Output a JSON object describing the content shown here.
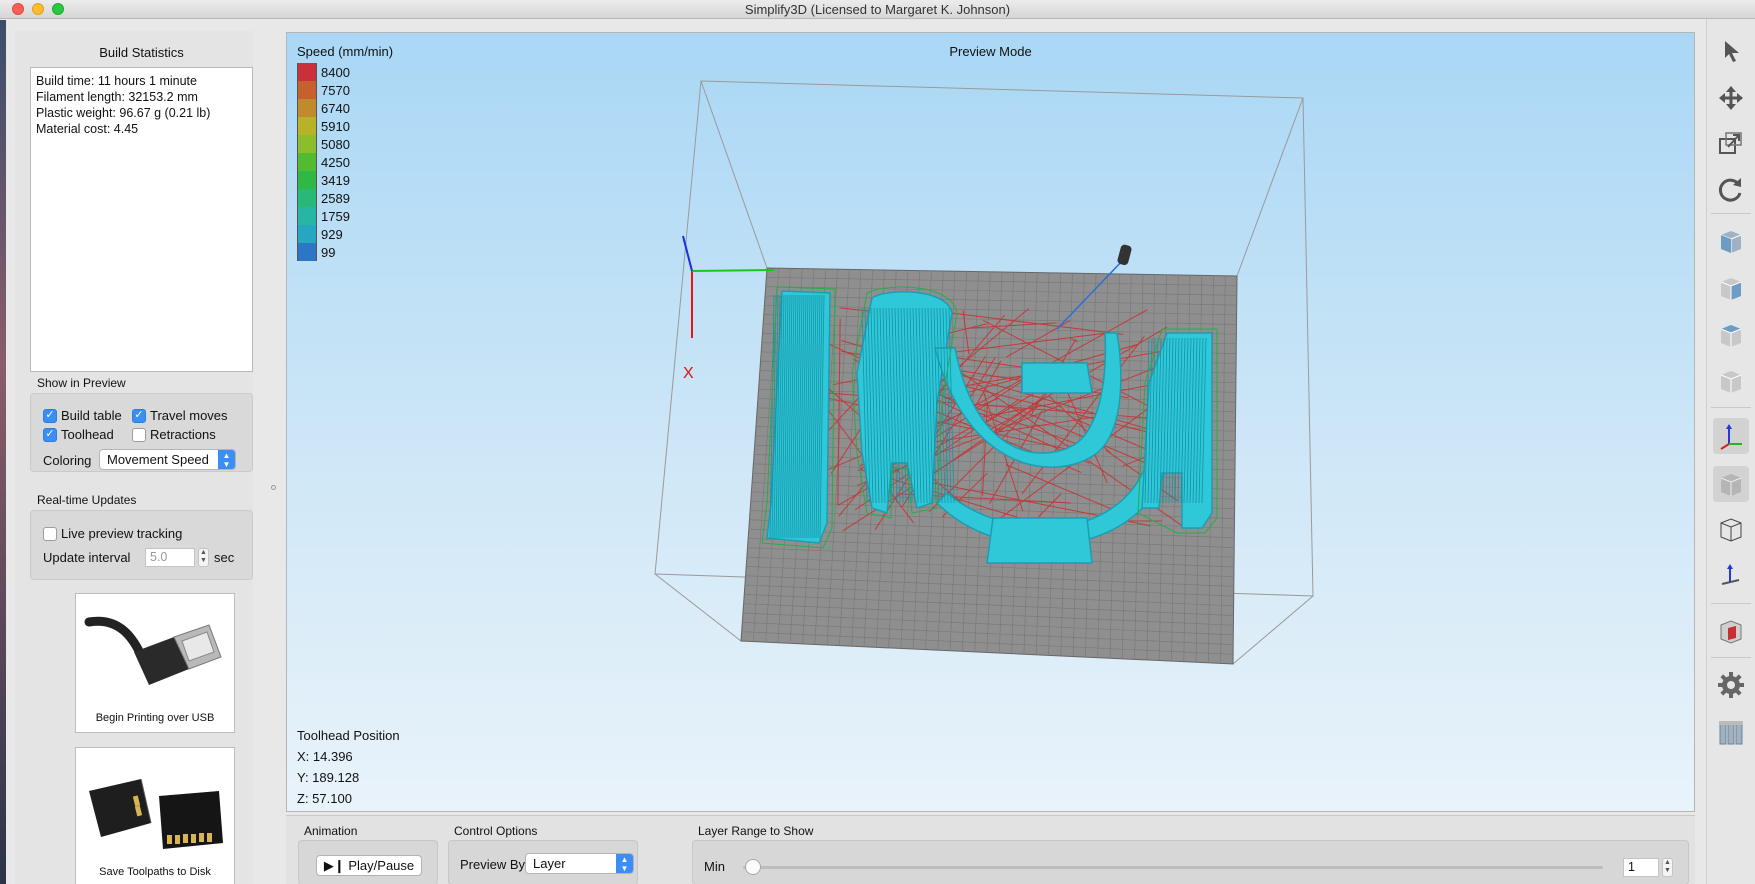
{
  "window": {
    "title": "Simplify3D (Licensed to Margaret K. Johnson)"
  },
  "build_statistics": {
    "heading": "Build Statistics",
    "lines": [
      "Build time: 11 hours 1 minute",
      "Filament length: 32153.2 mm",
      "Plastic weight: 96.67 g (0.21 lb)",
      "Material cost: 4.45"
    ]
  },
  "show_in_preview": {
    "heading": "Show in Preview",
    "build_table": {
      "label": "Build table",
      "checked": true
    },
    "travel_moves": {
      "label": "Travel moves",
      "checked": true
    },
    "toolhead": {
      "label": "Toolhead",
      "checked": true
    },
    "retractions": {
      "label": "Retractions",
      "checked": false
    },
    "coloring_label": "Coloring",
    "coloring_value": "Movement Speed"
  },
  "realtime": {
    "heading": "Real-time Updates",
    "live_label": "Live preview tracking",
    "live_checked": false,
    "interval_label": "Update interval",
    "interval_value": "5.0",
    "interval_unit": "sec"
  },
  "cards": {
    "usb_label": "Begin Printing over USB",
    "sd_label": "Save Toolpaths to Disk"
  },
  "viewport": {
    "preview_title": "Preview Mode",
    "legend_title": "Speed (mm/min)",
    "legend": [
      {
        "value": "8400",
        "color": "#c9303a"
      },
      {
        "value": "7570",
        "color": "#c6602f"
      },
      {
        "value": "6740",
        "color": "#c18a2c"
      },
      {
        "value": "5910",
        "color": "#b8b228"
      },
      {
        "value": "5080",
        "color": "#8cbd2c"
      },
      {
        "value": "4250",
        "color": "#52bb31"
      },
      {
        "value": "3419",
        "color": "#2fb845"
      },
      {
        "value": "2589",
        "color": "#28b878"
      },
      {
        "value": "1759",
        "color": "#27b6a4"
      },
      {
        "value": "929",
        "color": "#27a6c0"
      },
      {
        "value": "99",
        "color": "#2d76c6"
      }
    ],
    "toolhead_title": "Toolhead Position",
    "x": "X: 14.396",
    "y": "Y: 189.128",
    "z": "Z: 57.100",
    "axis_x_label": "X"
  },
  "animation": {
    "heading": "Animation",
    "play_label": "Play/Pause"
  },
  "control_options": {
    "heading": "Control Options",
    "preview_by_label": "Preview By",
    "preview_by_value": "Layer"
  },
  "layer_range": {
    "heading": "Layer Range to Show",
    "min_label": "Min",
    "min_value": "1"
  },
  "toolbar_icons": [
    "select-icon",
    "move-icon",
    "scale-icon",
    "rotate-icon",
    "view-front-icon",
    "view-side-icon",
    "view-top-icon",
    "view-iso-icon",
    "axes-icon",
    "solid-view-icon",
    "wireframe-view-icon",
    "normal-axis-icon",
    "cross-section-icon",
    "settings-icon",
    "supports-icon"
  ],
  "colors": {
    "accent": "#3a8ef6",
    "part": "#2ec8d8",
    "travel": "#d42020",
    "bed": "#8f8f8f"
  }
}
